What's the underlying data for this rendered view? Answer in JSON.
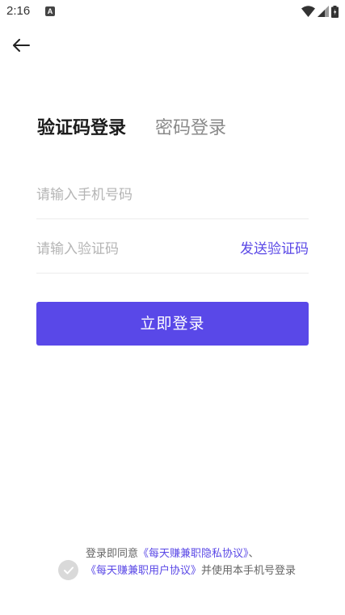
{
  "status_bar": {
    "time": "2:16",
    "notification_letter": "A"
  },
  "back": {
    "icon": "arrow-left-icon"
  },
  "tabs": [
    {
      "label": "验证码登录",
      "active": true
    },
    {
      "label": "密码登录",
      "active": false
    }
  ],
  "phone_field": {
    "placeholder": "请输入手机号码",
    "value": ""
  },
  "code_field": {
    "placeholder": "请输入验证码",
    "value": "",
    "send_label": "发送验证码"
  },
  "login_button": {
    "label": "立即登录"
  },
  "agreement": {
    "checked": false,
    "prefix": "登录即同意",
    "privacy_link": "《每天赚兼职隐私协议》",
    "separator": "、",
    "user_link": "《每天赚兼职用户协议》",
    "suffix": "并使用本手机号登录"
  },
  "colors": {
    "accent": "#5948e8",
    "link": "#5a48e6",
    "placeholder": "#b5b5b5"
  }
}
